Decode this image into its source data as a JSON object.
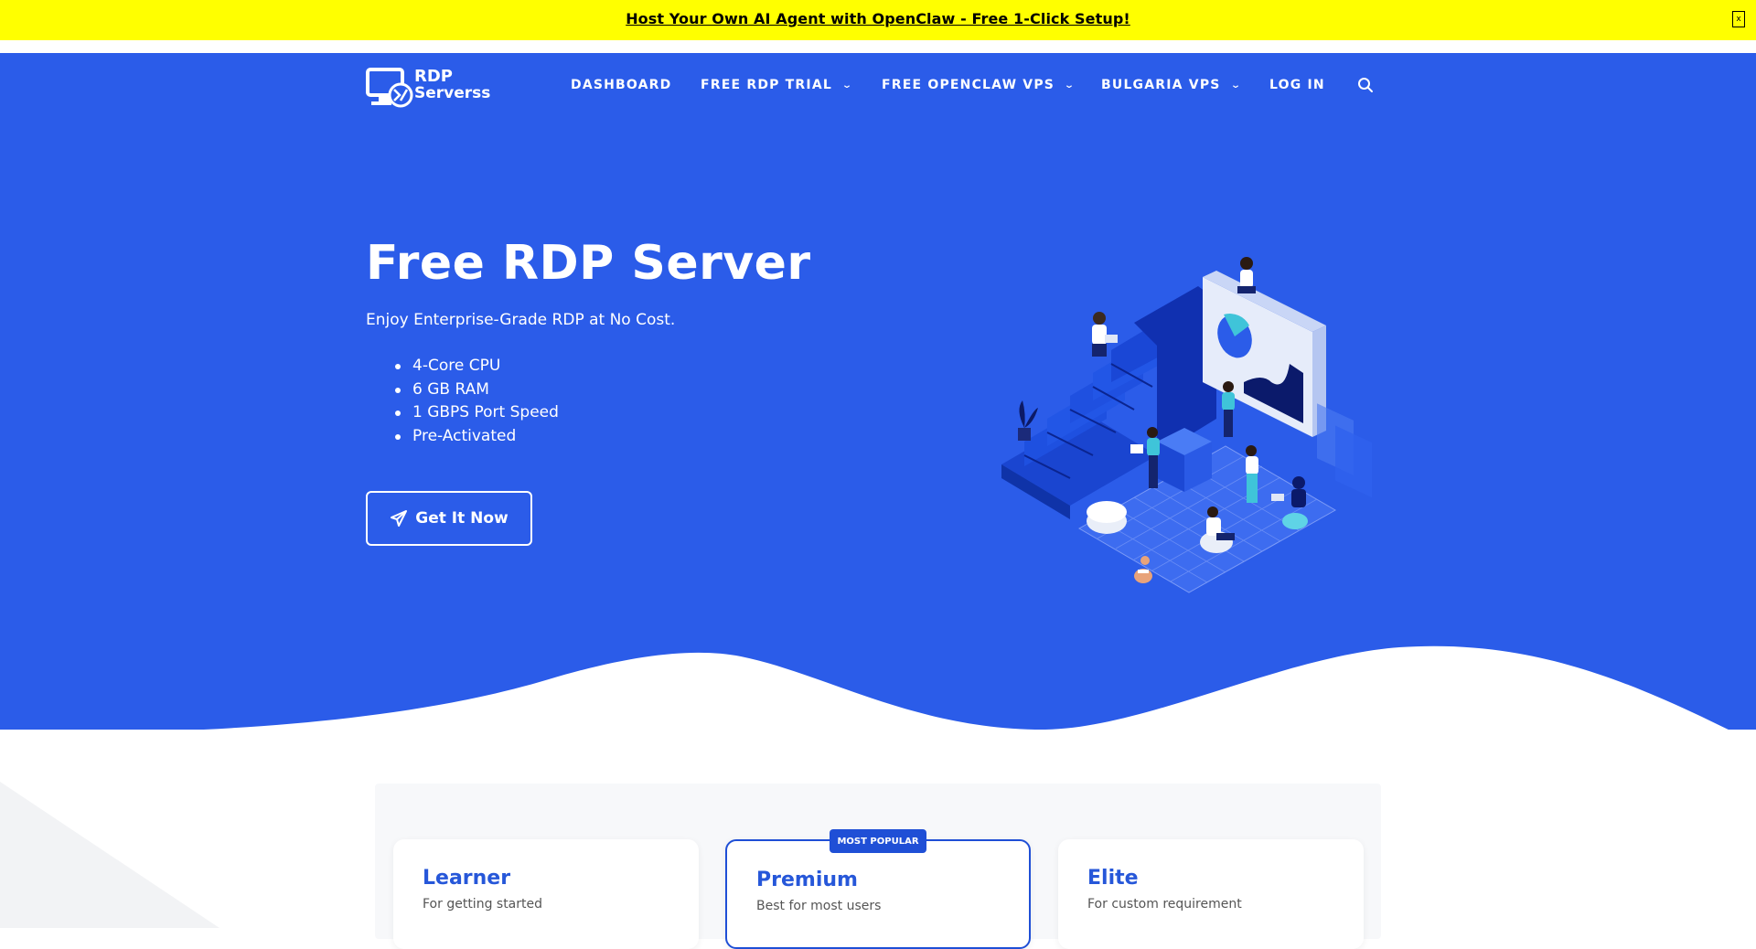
{
  "announcement": {
    "text": "Host Your Own AI Agent with OpenClaw - Free 1-Click Setup!",
    "close_icon": "close-icon"
  },
  "header": {
    "logo_line1": "RDP",
    "logo_line2": "Serverss",
    "nav": [
      {
        "label": "DASHBOARD",
        "has_dropdown": false
      },
      {
        "label": "FREE RDP TRIAL",
        "has_dropdown": true
      },
      {
        "label": "FREE OPENCLAW VPS",
        "has_dropdown": true
      },
      {
        "label": "BULGARIA VPS",
        "has_dropdown": true
      },
      {
        "label": "LOG IN",
        "has_dropdown": false
      }
    ],
    "search_icon": "search-icon"
  },
  "hero": {
    "title": "Free RDP Server",
    "subtitle": "Enjoy Enterprise-Grade RDP at No Cost.",
    "features": [
      "4-Core CPU",
      "6 GB RAM",
      "1 GBPS Port Speed",
      "Pre-Activated"
    ],
    "cta_label": "Get It Now",
    "cta_icon": "paper-plane-icon",
    "illustration": "isometric-team-illustration"
  },
  "pricing": {
    "badge": "MOST POPULAR",
    "plans": [
      {
        "name": "Learner",
        "desc": "For getting started"
      },
      {
        "name": "Premium",
        "desc": "Best for most users"
      },
      {
        "name": "Elite",
        "desc": "For custom requirement"
      }
    ]
  },
  "colors": {
    "announcement_bg": "#ffff00",
    "hero_bg": "#2b5ce9",
    "accent": "#1f4fd6",
    "plan_title": "#2657d9"
  }
}
